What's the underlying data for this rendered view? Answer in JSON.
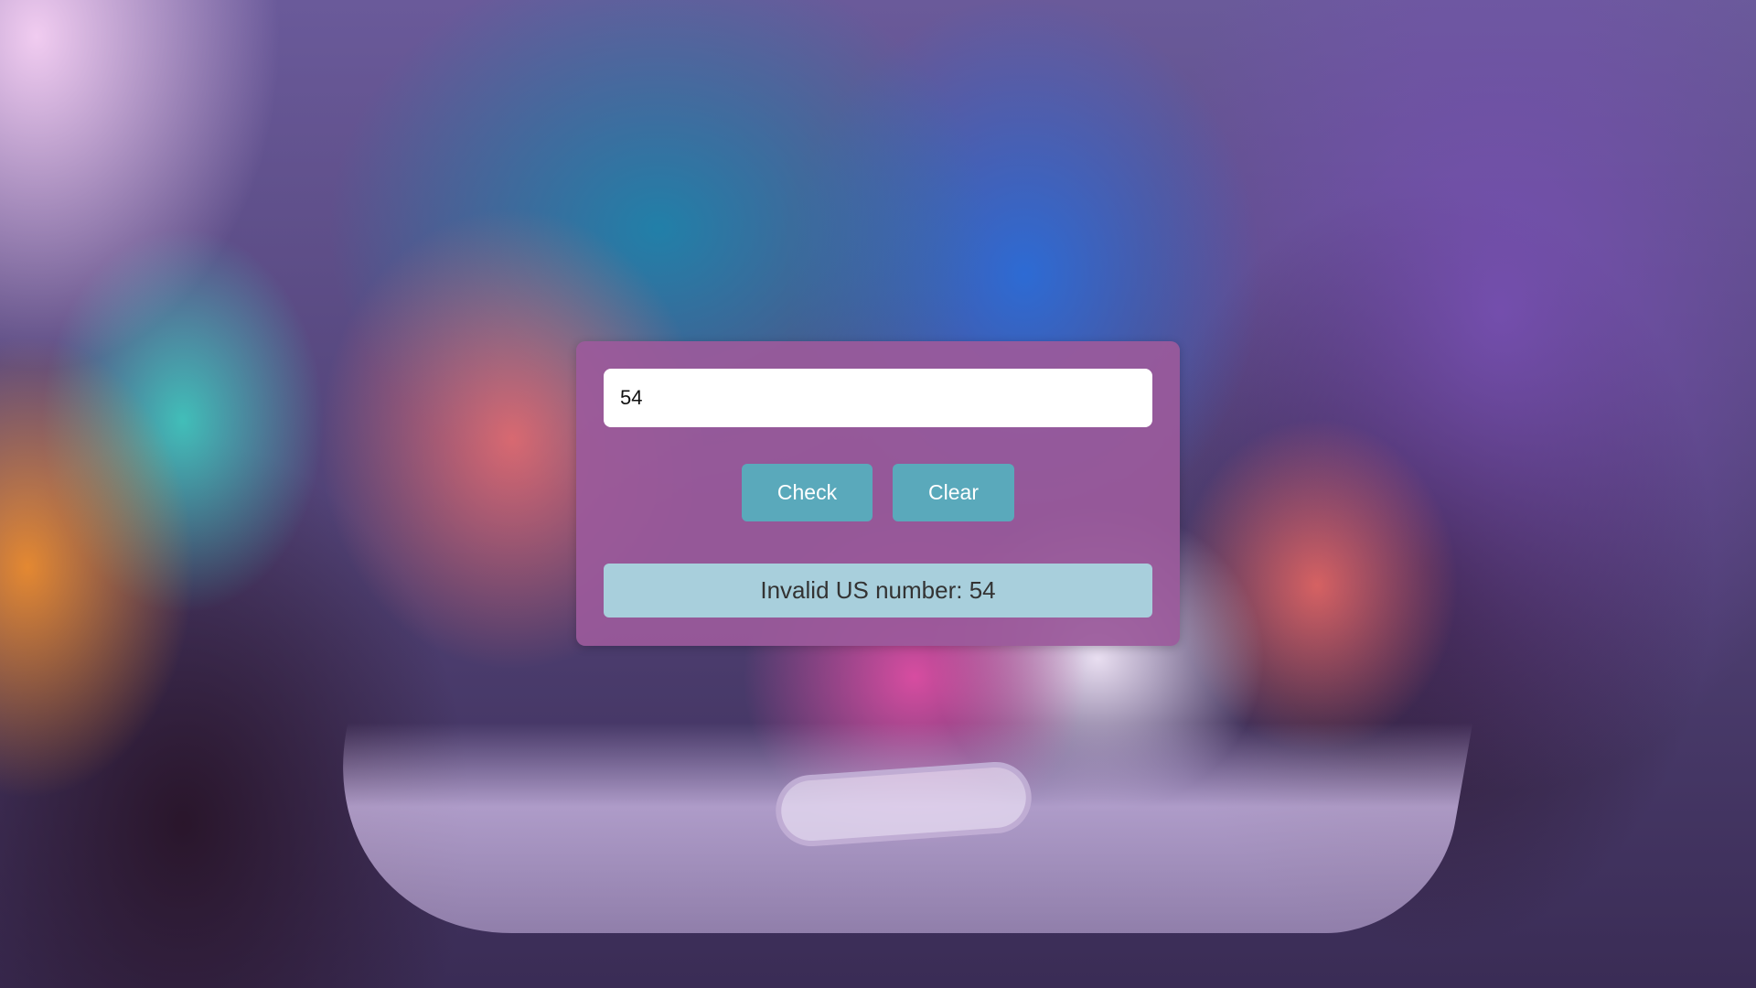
{
  "background": {
    "image": "blurred-smartphone-in-hand"
  },
  "form": {
    "phone_value": "54",
    "check_label": "Check",
    "clear_label": "Clear",
    "result_text": "Invalid US number: 54"
  },
  "colors": {
    "card": "#9b5a9b",
    "button": "#5aa9bb",
    "result_bg": "#a8cfdc"
  }
}
